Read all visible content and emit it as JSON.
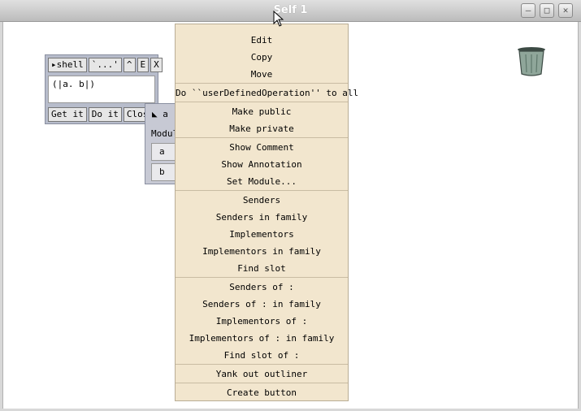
{
  "window": {
    "title": "Self 1",
    "buttons": [
      "minimize",
      "maximize",
      "close"
    ]
  },
  "shell": {
    "header": {
      "label": "shell",
      "quote": "`...'",
      "caret": "^",
      "e": "E",
      "x": "X"
    },
    "text": "(|a. b|)",
    "buttons": {
      "get_it": "Get it",
      "do_it": "Do it",
      "close": "Clos"
    }
  },
  "object_outliner": {
    "name": "a",
    "module_label": "Modul",
    "slots": [
      "a",
      "b"
    ]
  },
  "menu": {
    "groups": [
      [
        "Edit",
        "Copy",
        "Move"
      ],
      [
        "Do ``userDefinedOperation'' to all"
      ],
      [
        "Make public",
        "Make private"
      ],
      [
        "Show Comment",
        "Show Annotation",
        "Set Module..."
      ],
      [
        "Senders",
        "Senders in family",
        "Implementors",
        "Implementors in family",
        "Find slot"
      ],
      [
        "Senders of :",
        "Senders of : in family",
        "Implementors of :",
        "Implementors of : in family",
        "Find slot of :"
      ],
      [
        "Yank out outliner"
      ],
      [
        "Create button"
      ]
    ]
  },
  "icons": {
    "trash": "trash-can-icon",
    "cursor": "mouse-pointer-icon"
  }
}
